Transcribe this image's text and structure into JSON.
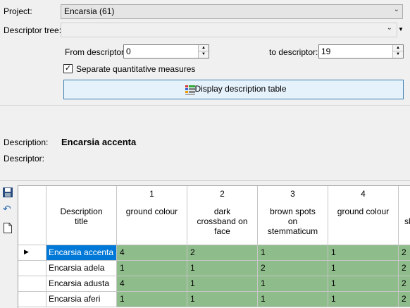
{
  "form": {
    "project_label": "Project:",
    "project_value": "Encarsia (61)",
    "descriptor_tree_label": "Descriptor tree:",
    "descriptor_tree_value": "",
    "from_descriptor_label": "From descriptor:",
    "from_descriptor_value": "0",
    "to_descriptor_label": "to descriptor:",
    "to_descriptor_value": "19",
    "separate_label": "Separate quantitative measures",
    "separate_checked": true,
    "display_button_label": "Display description table"
  },
  "info": {
    "description_label": "Description:",
    "description_value": "Encarsia accenta",
    "descriptor_label": "Descriptor:"
  },
  "table": {
    "title_header": "Description title",
    "title_header_lines": [
      "Description",
      "title"
    ],
    "columns": [
      {
        "number": "1",
        "lines": [
          "ground colour"
        ]
      },
      {
        "number": "2",
        "lines": [
          "dark",
          "crossband on",
          "face"
        ]
      },
      {
        "number": "3",
        "lines": [
          "brown spots",
          "on",
          "stemmaticum"
        ]
      },
      {
        "number": "4",
        "lines": [
          "ground colour"
        ]
      },
      {
        "number": "",
        "lines": [
          "sl"
        ]
      }
    ],
    "rows": [
      {
        "title": "Encarsia accenta",
        "values": [
          "4",
          "2",
          "1",
          "1",
          "2"
        ],
        "current": true
      },
      {
        "title": "Encarsia adela",
        "values": [
          "1",
          "1",
          "2",
          "1",
          "2"
        ],
        "current": false
      },
      {
        "title": "Encarsia adusta",
        "values": [
          "4",
          "1",
          "1",
          "1",
          "2"
        ],
        "current": false
      },
      {
        "title": "Encarsia aferi",
        "values": [
          "1",
          "1",
          "1",
          "1",
          "2"
        ],
        "current": false
      }
    ]
  },
  "colors": {
    "value_cell": "#8fbc8b",
    "selected_cell": "#0078d7"
  }
}
